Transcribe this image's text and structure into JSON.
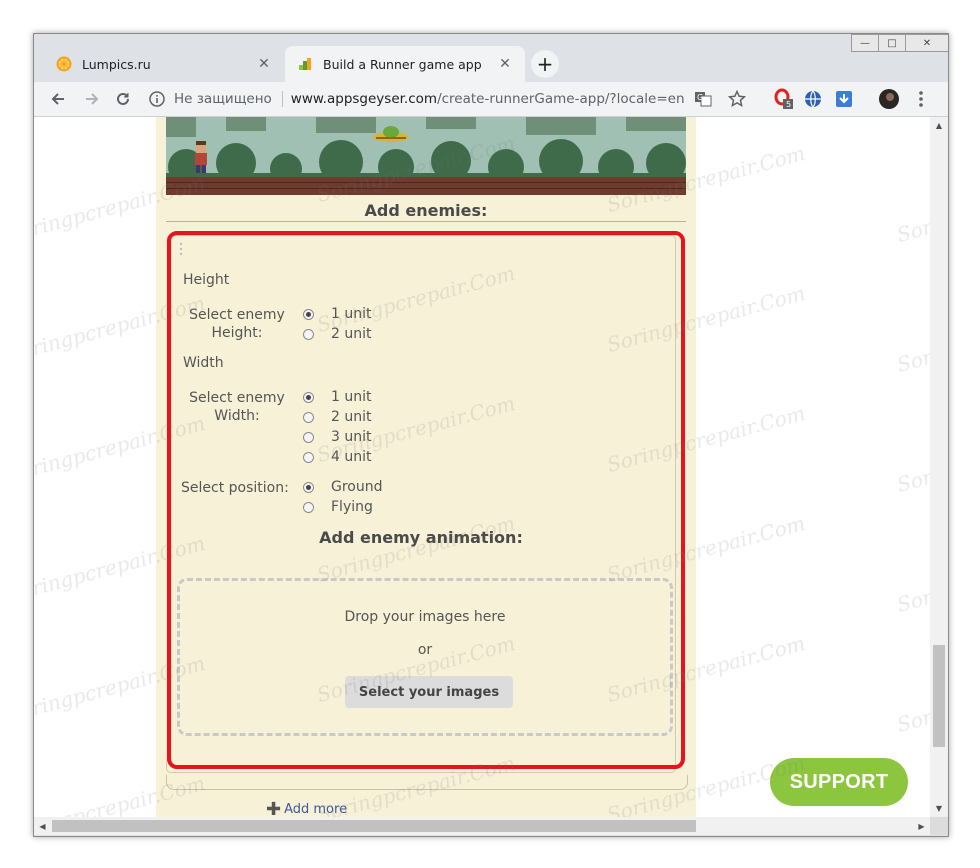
{
  "browser": {
    "tabs": [
      {
        "title": "Lumpics.ru",
        "active": false,
        "icon": "orange-slice-icon"
      },
      {
        "title": "Build a Runner game app",
        "active": true,
        "icon": "appsgeyser-icon"
      }
    ],
    "new_tab_label": "+",
    "close_glyph": "✕",
    "security_text": "Не защищено",
    "url_host": "www.appsgeyser.com",
    "url_path": "/create-runnerGame-app/?locale=en",
    "extension_badge": "5"
  },
  "page": {
    "add_enemies_title": "Add enemies:",
    "height_group": {
      "heading": "Height",
      "label": "Select enemy Height:",
      "options": [
        "1 unit",
        "2 unit"
      ],
      "selected": "1 unit"
    },
    "width_group": {
      "heading": "Width",
      "label": "Select enemy Width:",
      "options": [
        "1 unit",
        "2 unit",
        "3 unit",
        "4 unit"
      ],
      "selected": "1 unit"
    },
    "position_group": {
      "label": "Select position:",
      "options": [
        "Ground",
        "Flying"
      ],
      "selected": "Ground"
    },
    "animation_title": "Add enemy animation:",
    "dropzone": {
      "drop_text": "Drop your images here",
      "or_text": "or",
      "button_label": "Select your images"
    },
    "add_more_label": "Add more",
    "support_label": "SUPPORT"
  },
  "watermark": "Soringpcrepair.Com",
  "colors": {
    "highlight": "#e8141c",
    "support": "#8cc63f",
    "panel": "#f7f1d8"
  }
}
